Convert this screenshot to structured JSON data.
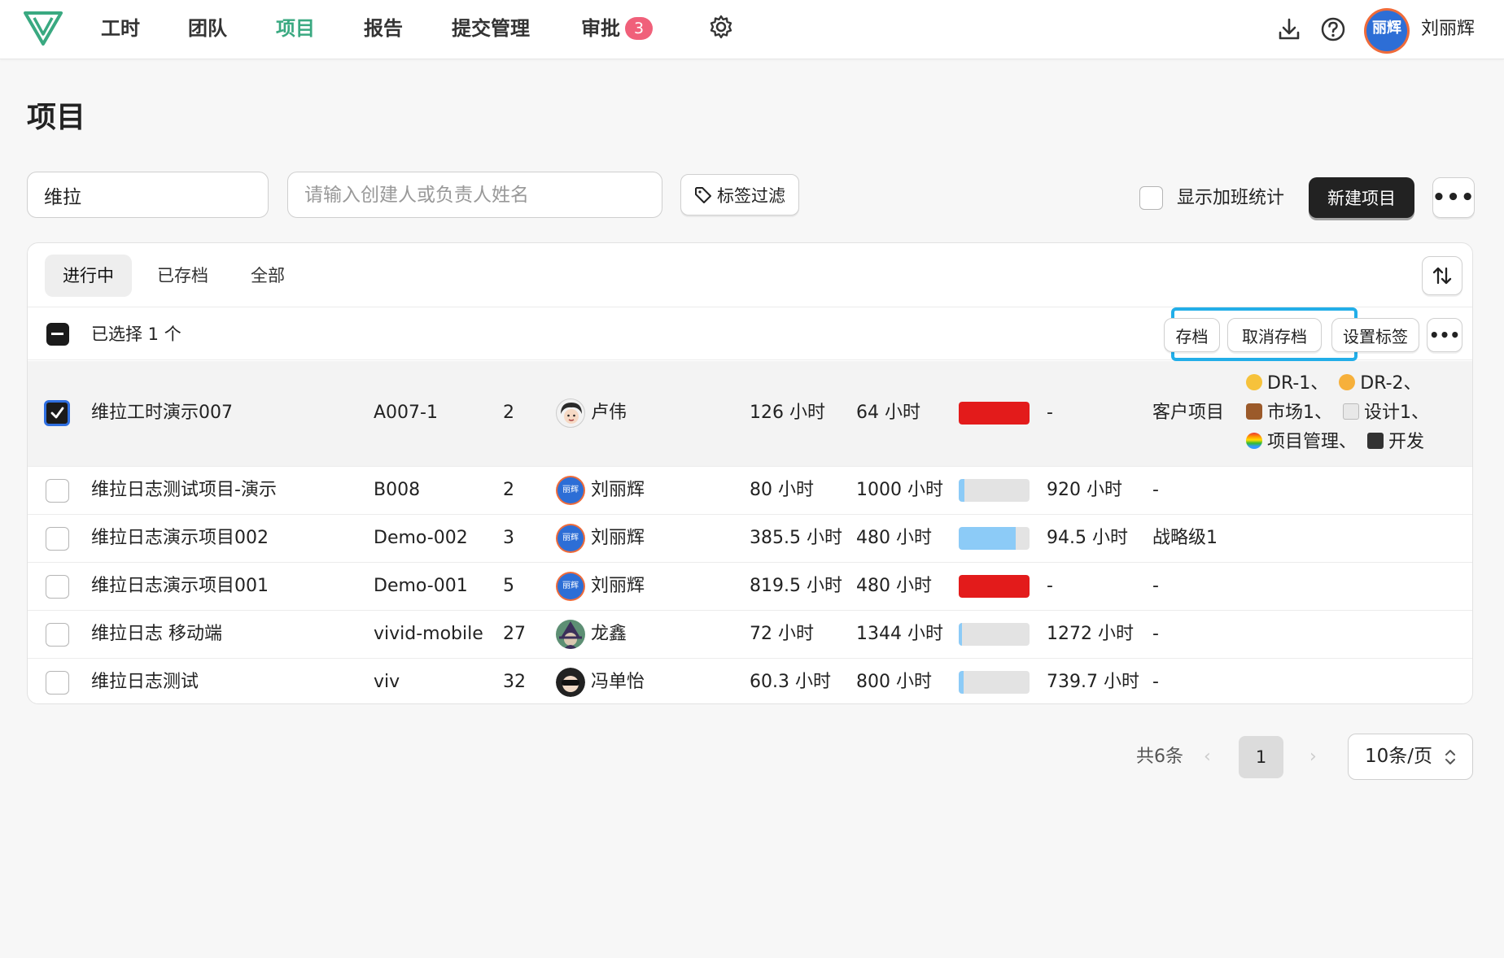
{
  "nav": {
    "items": [
      "工时",
      "团队",
      "项目",
      "报告",
      "提交管理",
      "审批"
    ],
    "active_index": 2,
    "approval_badge": "3",
    "user_name": "刘丽辉",
    "avatar_text": "丽辉",
    "icons": [
      "logo-icon",
      "gear-icon",
      "download-icon",
      "help-icon"
    ],
    "accent_color": "#3aa981"
  },
  "page": {
    "title": "项目"
  },
  "filters": {
    "search_value": "维拉",
    "person_placeholder": "请输入创建人或负责人姓名",
    "tag_filter_label": "标签过滤",
    "overtime_label": "显示加班统计",
    "new_project_label": "新建项目"
  },
  "tabs": [
    "进行中",
    "已存档",
    "全部"
  ],
  "active_tab": 0,
  "selection": {
    "text": "已选择 1 个",
    "archive_label": "存档",
    "unarchive_label": "取消存档",
    "set_tags_label": "设置标签"
  },
  "rows": [
    {
      "name": "维拉工时演示007",
      "code": "A007-1",
      "members": "2",
      "owner": "卢伟",
      "used": "126 小时",
      "budget": "64 小时",
      "progress": 1.0,
      "progress_color": "#e31b1b",
      "remaining": "-",
      "category": "客户项目",
      "tags": [
        "DR-1、",
        "DR-2、",
        "市场1、",
        "设计1、",
        "项目管理、",
        "开发"
      ],
      "checked": true,
      "avatar": "luwei"
    },
    {
      "name": "维拉日志测试项目-演示",
      "code": "B008",
      "members": "2",
      "owner": "刘丽辉",
      "used": "80 小时",
      "budget": "1000 小时",
      "progress": 0.08,
      "progress_color": "#8ccbf7",
      "remaining": "920 小时",
      "category": "-",
      "tags": [],
      "checked": false,
      "avatar": "liulihui"
    },
    {
      "name": "维拉日志演示项目002",
      "code": "Demo-002",
      "members": "3",
      "owner": "刘丽辉",
      "used": "385.5 小时",
      "budget": "480 小时",
      "progress": 0.8,
      "progress_color": "#8ccbf7",
      "remaining": "94.5 小时",
      "category": "战略级1",
      "tags": [],
      "checked": false,
      "avatar": "liulihui"
    },
    {
      "name": "维拉日志演示项目001",
      "code": "Demo-001",
      "members": "5",
      "owner": "刘丽辉",
      "used": "819.5 小时",
      "budget": "480 小时",
      "progress": 1.0,
      "progress_color": "#e31b1b",
      "remaining": "-",
      "category": "-",
      "tags": [],
      "checked": false,
      "avatar": "liulihui"
    },
    {
      "name": "维拉日志 移动端",
      "code": "vivid-mobile",
      "members": "27",
      "owner": "龙鑫",
      "used": "72 小时",
      "budget": "1344 小时",
      "progress": 0.05,
      "progress_color": "#8ccbf7",
      "remaining": "1272 小时",
      "category": "-",
      "tags": [],
      "checked": false,
      "avatar": "longxin"
    },
    {
      "name": "维拉日志测试",
      "code": "viv",
      "members": "32",
      "owner": "冯单怡",
      "used": "60.3 小时",
      "budget": "800 小时",
      "progress": 0.07,
      "progress_color": "#8ccbf7",
      "remaining": "739.7 小时",
      "category": "-",
      "tags": [],
      "checked": false,
      "avatar": "fengdanyi"
    }
  ],
  "pagination": {
    "total": "共6条",
    "page": "1",
    "page_size": "10条/页"
  }
}
